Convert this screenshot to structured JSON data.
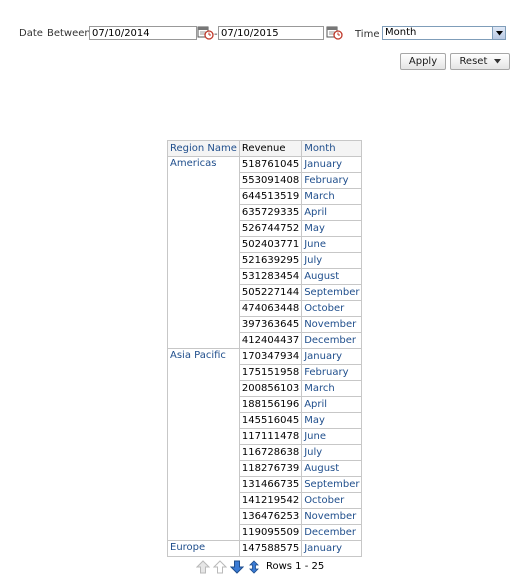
{
  "prompts": {
    "date_label": "Date",
    "between_label": "Between",
    "start_date": "07/10/2014",
    "end_date": "07/10/2015",
    "range_separator": "-",
    "time_label": "Time",
    "time_selected": "Month",
    "apply_label": "Apply",
    "reset_label": "Reset"
  },
  "table": {
    "headers": {
      "region": "Region Name",
      "revenue": "Revenue",
      "month": "Month"
    },
    "groups": [
      {
        "region": "Americas",
        "rows": [
          {
            "revenue": "518761045",
            "month": "January"
          },
          {
            "revenue": "553091408",
            "month": "February"
          },
          {
            "revenue": "644513519",
            "month": "March"
          },
          {
            "revenue": "635729335",
            "month": "April"
          },
          {
            "revenue": "526744752",
            "month": "May"
          },
          {
            "revenue": "502403771",
            "month": "June"
          },
          {
            "revenue": "521639295",
            "month": "July"
          },
          {
            "revenue": "531283454",
            "month": "August"
          },
          {
            "revenue": "505227144",
            "month": "September"
          },
          {
            "revenue": "474063448",
            "month": "October"
          },
          {
            "revenue": "397363645",
            "month": "November"
          },
          {
            "revenue": "412404437",
            "month": "December"
          }
        ]
      },
      {
        "region": "Asia Pacific",
        "rows": [
          {
            "revenue": "170347934",
            "month": "January"
          },
          {
            "revenue": "175151958",
            "month": "February"
          },
          {
            "revenue": "200856103",
            "month": "March"
          },
          {
            "revenue": "188156196",
            "month": "April"
          },
          {
            "revenue": "145516045",
            "month": "May"
          },
          {
            "revenue": "117111478",
            "month": "June"
          },
          {
            "revenue": "116728638",
            "month": "July"
          },
          {
            "revenue": "118276739",
            "month": "August"
          },
          {
            "revenue": "131466735",
            "month": "September"
          },
          {
            "revenue": "141219542",
            "month": "October"
          },
          {
            "revenue": "136476253",
            "month": "November"
          },
          {
            "revenue": "119095509",
            "month": "December"
          }
        ]
      },
      {
        "region": "Europe",
        "rows": [
          {
            "revenue": "147588575",
            "month": "January"
          }
        ]
      }
    ]
  },
  "pager": {
    "rows_text": "Rows 1 - 25"
  },
  "colors": {
    "link": "#1f4e8c",
    "border": "#c7c7c7",
    "pager_arrow": "#3a7bd5",
    "pager_arrow_disabled": "#b9b9b9"
  }
}
